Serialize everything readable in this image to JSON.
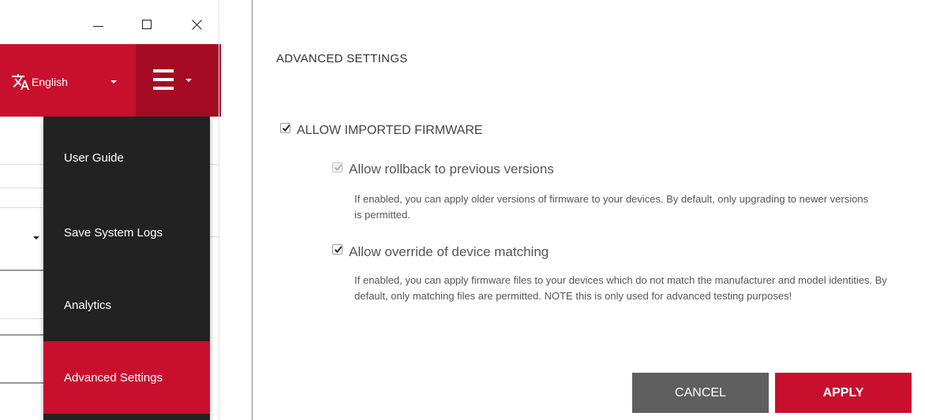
{
  "window": {
    "minimize_icon": "minimize-icon",
    "maximize_icon": "maximize-icon",
    "close_icon": "close-icon"
  },
  "header": {
    "language_label": "English",
    "language_icon": "translate-icon",
    "menu_icon": "hamburger-icon",
    "brand_color": "#c8102e"
  },
  "menu": {
    "items": [
      {
        "label": "User Guide",
        "active": false
      },
      {
        "label": "Save System Logs",
        "active": false
      },
      {
        "label": "Analytics",
        "active": false
      },
      {
        "label": "Advanced Settings",
        "active": true
      }
    ]
  },
  "dialog": {
    "title": "ADVANCED SETTINGS",
    "allow_imported": {
      "label": "ALLOW IMPORTED FIRMWARE",
      "checked": true
    },
    "rollback": {
      "label": "Allow rollback to previous versions",
      "checked": true,
      "disabled": true,
      "description": "If enabled, you can apply older versions of firmware to your devices. By default, only upgrading to newer versions is permitted."
    },
    "override": {
      "label": "Allow override of device matching",
      "checked": true,
      "description": "If enabled, you can apply firmware files to your devices which do not match the manufacturer and model identities. By default, only matching files are permitted. NOTE this is only used for advanced testing purposes!"
    },
    "cancel_label": "CANCEL",
    "apply_label": "APPLY"
  }
}
